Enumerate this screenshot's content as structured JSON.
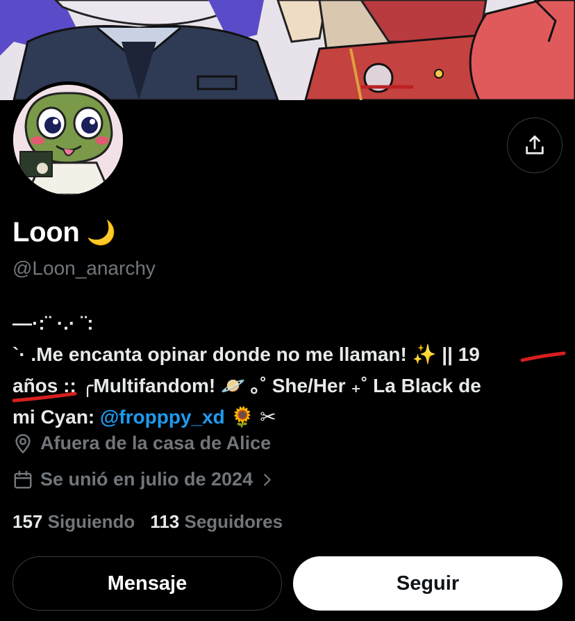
{
  "profile": {
    "display_name": "Loon",
    "name_emoji": "🌙",
    "handle": "@Loon_anarchy",
    "bio": {
      "line1": "—·:¨ ·.· ¨:",
      "line2_a": "`· .Me encanta opinar donde no me llaman! ✨ || ",
      "line2_b": "19",
      "line3_a": "años",
      "line3_b": " :: ╭Multifandom! 🪐 ｡˚ She/Her ₊˚ La Black de",
      "line4_a": "mi Cyan: ",
      "mention": "@fropppy_xd",
      "line4_b": " 🌻 ✂"
    },
    "location": "Afuera de la casa de Alice",
    "joined": "Se unió en julio de 2024",
    "following_count": "157",
    "following_label": "Siguiendo",
    "followers_count": "113",
    "followers_label": "Seguidores"
  },
  "actions": {
    "message_label": "Mensaje",
    "follow_label": "Seguir"
  },
  "icons": {
    "share": "share-icon",
    "location": "location-pin-icon",
    "calendar": "calendar-icon",
    "chevron": "chevron-right-icon"
  },
  "colors": {
    "background": "#000000",
    "text": "#e7e9ea",
    "muted": "#71767b",
    "link": "#1d9bf0",
    "annotation": "#d61f1f"
  }
}
